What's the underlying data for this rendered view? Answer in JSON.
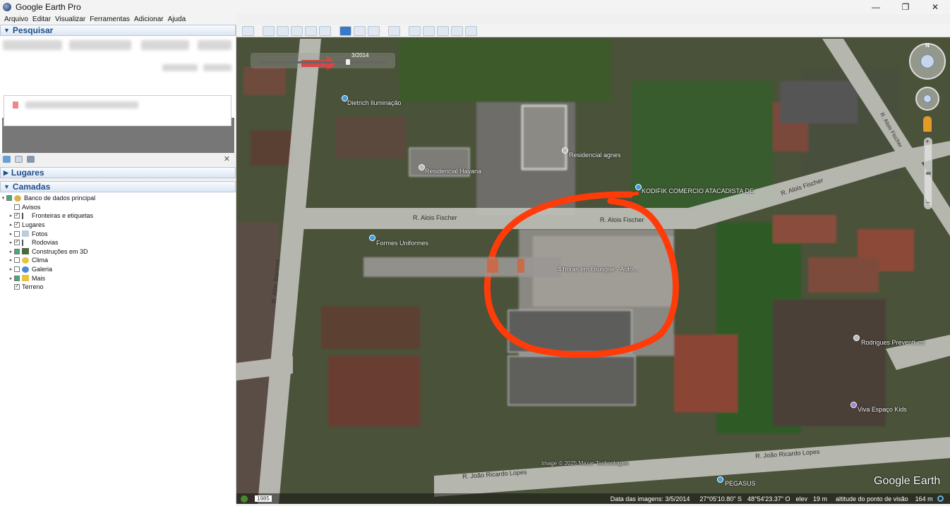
{
  "window": {
    "title": "Google Earth Pro",
    "minimize_glyph": "—",
    "maximize_glyph": "❐",
    "close_glyph": "✕"
  },
  "menu": [
    "Arquivo",
    "Editar",
    "Visualizar",
    "Ferramentas",
    "Adicionar",
    "Ajuda"
  ],
  "panels": {
    "search": {
      "title": "Pesquisar"
    },
    "places": {
      "title": "Lugares"
    },
    "layers": {
      "title": "Camadas"
    },
    "close_glyph": "✕"
  },
  "layers": [
    {
      "label": "Banco de dados principal",
      "checked": "partial",
      "expander": "▾"
    },
    {
      "label": "Avisos",
      "checked": "off",
      "expander": ""
    },
    {
      "label": "Fronteiras e etiquetas",
      "checked": "on",
      "expander": "▸"
    },
    {
      "label": "Lugares",
      "checked": "on",
      "expander": "▸"
    },
    {
      "label": "Fotos",
      "checked": "off",
      "expander": "▸"
    },
    {
      "label": "Rodovias",
      "checked": "on",
      "expander": "▸"
    },
    {
      "label": "Construções em 3D",
      "checked": "partial",
      "expander": "▸"
    },
    {
      "label": "Clima",
      "checked": "off",
      "expander": "▸"
    },
    {
      "label": "Galeria",
      "checked": "off",
      "expander": "▸"
    },
    {
      "label": "Mais",
      "checked": "partial",
      "expander": "▸"
    },
    {
      "label": "Terreno",
      "checked": "on",
      "expander": ""
    }
  ],
  "map": {
    "time_slider_date": "3/2014",
    "labels": {
      "dietrich": "Dietrich Iluminação",
      "residencial_agnes": "Residencial agnes",
      "residencial_havana": "Residencial Havana",
      "kodifik": "KODIFIK COMERCIO ATACADISTA DE",
      "alois1": "R. Alois Fischer",
      "alois2": "R. Alois Fischer",
      "alois3": "R. Alois Fischer",
      "formes": "Formes Uniformes",
      "horas": "4 horas em Brusque - Auto...",
      "barroso": "R. Alm. Barroso",
      "rodrigues": "Rodrigues Preventivos",
      "viva": "Viva Espaço Kids",
      "joao1": "R. João Ricardo Lopes",
      "joao2": "R. João Ricardo Lopes",
      "copyright": "Image © 2025 Maxar Technologies",
      "pegasus": "PEGASUS",
      "brand": "Google Earth",
      "street_top_right": "R. Alois Fischer"
    },
    "compass_north": "N"
  },
  "status": {
    "year": "1985",
    "date": "Data das imagens: 3/5/2014",
    "lat": "27°05'10.80\" S",
    "lon": "48°54'23.37\" O",
    "elev_label": "elev",
    "elev": "19 m",
    "eye_label": "altitude do ponto de visão",
    "eye": "164 m"
  },
  "colors": {
    "annotation": "#ff3b0a",
    "header_text": "#1d4f8a"
  }
}
